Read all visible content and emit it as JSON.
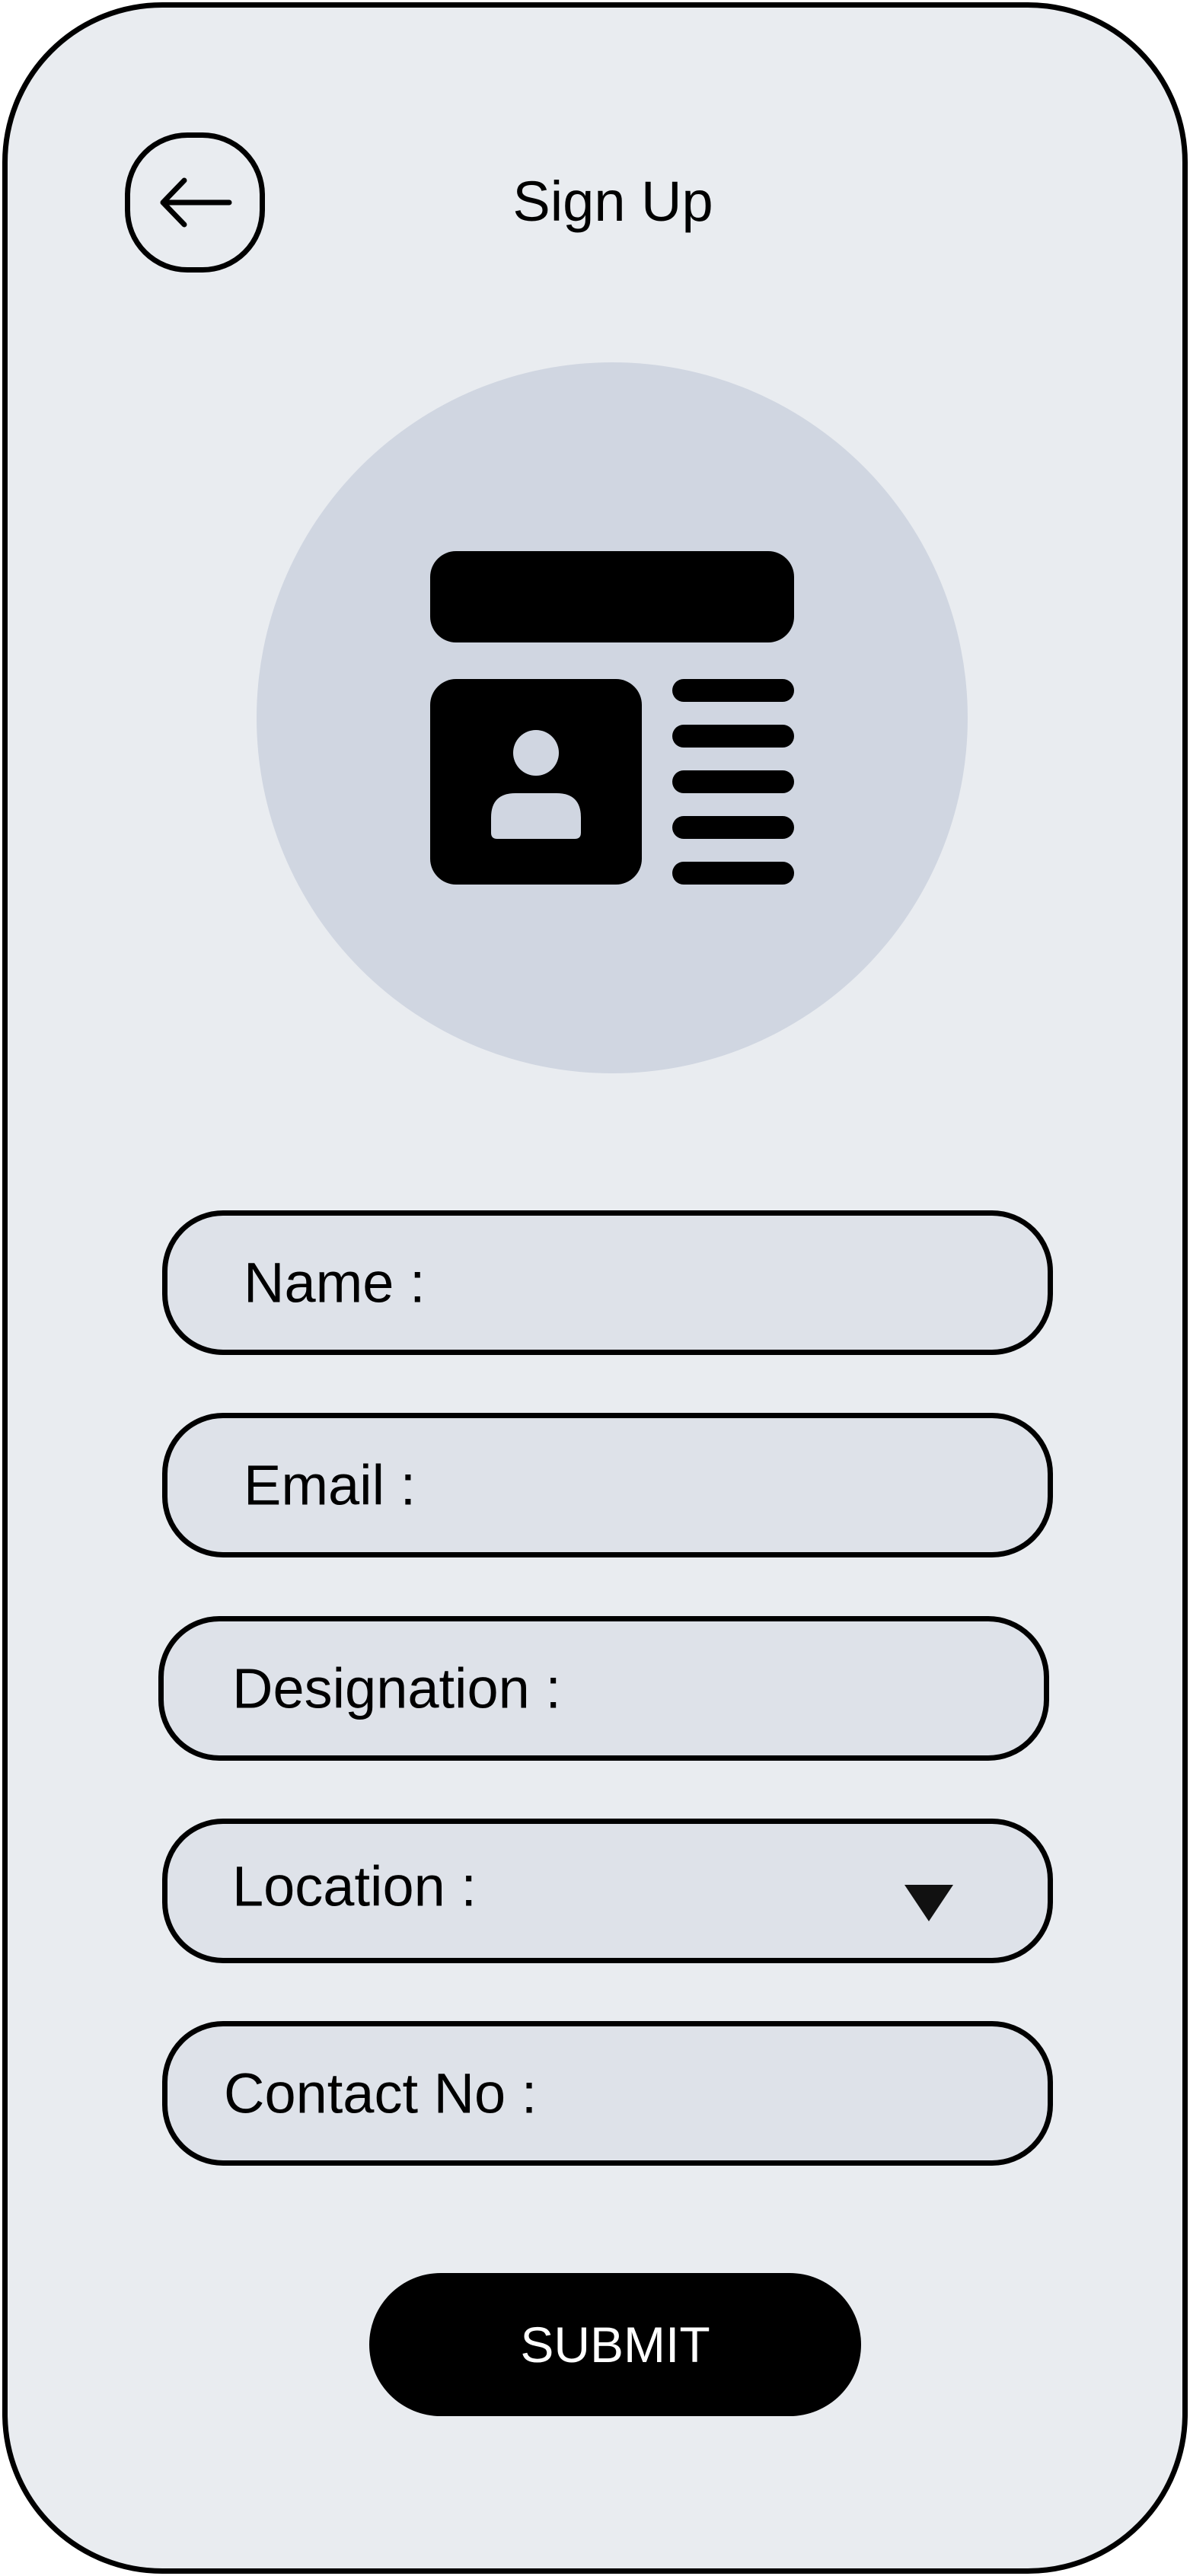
{
  "header": {
    "title": "Sign Up",
    "back_icon": "arrow-left-icon"
  },
  "avatar": {
    "icon": "id-card-profile-icon",
    "circle_color": "#d0d6e1"
  },
  "form": {
    "fields": [
      {
        "label": "Name :"
      },
      {
        "label": "Email :"
      },
      {
        "label": "Designation :"
      },
      {
        "label": "Location :",
        "dropdown_icon": "triangle-down-icon"
      },
      {
        "label": "Contact No :"
      }
    ],
    "submit_label": "SUBMIT"
  },
  "colors": {
    "background": "#e9ecf0",
    "field_fill": "#dee2e9",
    "outline": "#000000",
    "button": "#000000",
    "button_text": "#ffffff"
  }
}
